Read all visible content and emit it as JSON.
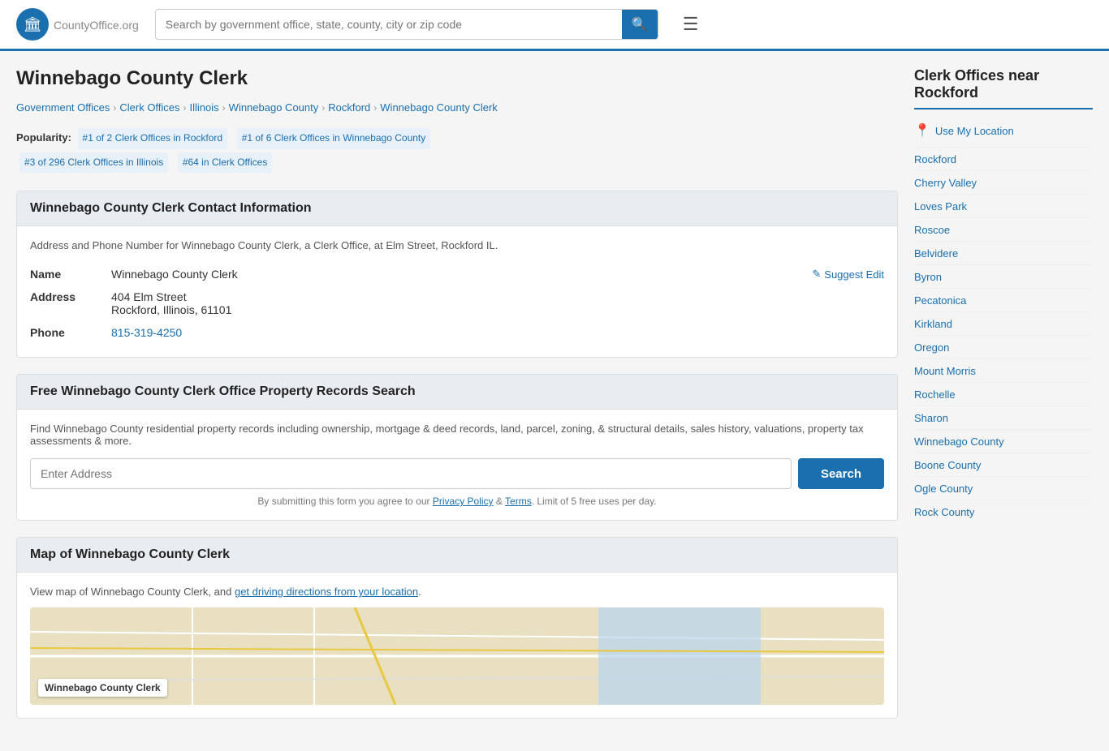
{
  "header": {
    "logo_text": "CountyOffice",
    "logo_suffix": ".org",
    "search_placeholder": "Search by government office, state, county, city or zip code",
    "search_icon": "🔍"
  },
  "page": {
    "title": "Winnebago County Clerk",
    "breadcrumb": [
      {
        "label": "Government Offices",
        "href": "#"
      },
      {
        "label": "Clerk Offices",
        "href": "#"
      },
      {
        "label": "Illinois",
        "href": "#"
      },
      {
        "label": "Winnebago County",
        "href": "#"
      },
      {
        "label": "Rockford",
        "href": "#"
      },
      {
        "label": "Winnebago County Clerk",
        "href": "#"
      }
    ]
  },
  "popularity": {
    "label": "Popularity:",
    "badges": [
      "#1 of 2 Clerk Offices in Rockford",
      "#1 of 6 Clerk Offices in Winnebago County",
      "#3 of 296 Clerk Offices in Illinois",
      "#64 in Clerk Offices"
    ]
  },
  "contact_section": {
    "title": "Winnebago County Clerk Contact Information",
    "description": "Address and Phone Number for Winnebago County Clerk, a Clerk Office, at Elm Street, Rockford IL.",
    "name_label": "Name",
    "name_value": "Winnebago County Clerk",
    "address_label": "Address",
    "address_line1": "404 Elm Street",
    "address_line2": "Rockford, Illinois, 61101",
    "phone_label": "Phone",
    "phone_value": "815-319-4250",
    "suggest_edit_label": "Suggest Edit"
  },
  "property_section": {
    "title": "Free Winnebago County Clerk Office Property Records Search",
    "description": "Find Winnebago County residential property records including ownership, mortgage & deed records, land, parcel, zoning, & structural details, sales history, valuations, property tax assessments & more.",
    "address_placeholder": "Enter Address",
    "search_button": "Search",
    "privacy_note": "By submitting this form you agree to our",
    "privacy_policy_label": "Privacy Policy",
    "terms_label": "Terms",
    "limit_note": "Limit of 5 free uses per day."
  },
  "map_section": {
    "title": "Map of Winnebago County Clerk",
    "description": "View map of Winnebago County Clerk, and",
    "directions_link": "get driving directions from your location",
    "map_label": "Winnebago County Clerk"
  },
  "sidebar": {
    "title": "Clerk Offices near Rockford",
    "use_location_label": "Use My Location",
    "items": [
      {
        "label": "Rockford",
        "href": "#"
      },
      {
        "label": "Cherry Valley",
        "href": "#"
      },
      {
        "label": "Loves Park",
        "href": "#"
      },
      {
        "label": "Roscoe",
        "href": "#"
      },
      {
        "label": "Belvidere",
        "href": "#"
      },
      {
        "label": "Byron",
        "href": "#"
      },
      {
        "label": "Pecatonica",
        "href": "#"
      },
      {
        "label": "Kirkland",
        "href": "#"
      },
      {
        "label": "Oregon",
        "href": "#"
      },
      {
        "label": "Mount Morris",
        "href": "#"
      },
      {
        "label": "Rochelle",
        "href": "#"
      },
      {
        "label": "Sharon",
        "href": "#"
      },
      {
        "label": "Winnebago County",
        "href": "#"
      },
      {
        "label": "Boone County",
        "href": "#"
      },
      {
        "label": "Ogle County",
        "href": "#"
      },
      {
        "label": "Rock County",
        "href": "#"
      }
    ]
  }
}
